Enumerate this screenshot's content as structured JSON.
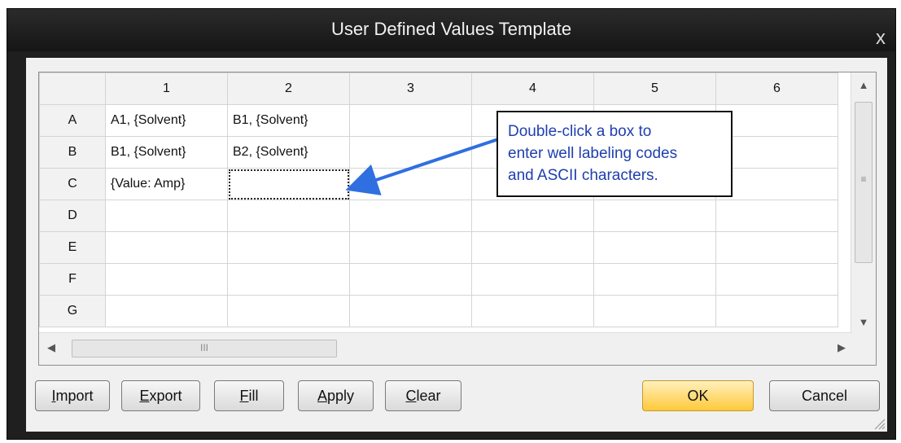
{
  "window": {
    "title": "User Defined Values Template",
    "close_symbol": "x"
  },
  "grid": {
    "columns": [
      "1",
      "2",
      "3",
      "4",
      "5",
      "6"
    ],
    "rows": [
      {
        "label": "A",
        "cells": [
          "A1, {Solvent}",
          "B1, {Solvent}",
          "",
          "",
          "",
          ""
        ]
      },
      {
        "label": "B",
        "cells": [
          "B1, {Solvent}",
          "B2, {Solvent}",
          "",
          "",
          "",
          ""
        ]
      },
      {
        "label": "C",
        "cells": [
          "{Value: Amp}",
          "",
          "",
          "",
          "",
          ""
        ]
      },
      {
        "label": "D",
        "cells": [
          "",
          "",
          "",
          "",
          "",
          ""
        ]
      },
      {
        "label": "E",
        "cells": [
          "",
          "",
          "",
          "",
          "",
          ""
        ]
      },
      {
        "label": "F",
        "cells": [
          "",
          "",
          "",
          "",
          "",
          ""
        ]
      },
      {
        "label": "G",
        "cells": [
          "",
          "",
          "",
          "",
          "",
          ""
        ]
      }
    ],
    "selected_cell": "C2"
  },
  "scrollbars": {
    "grip_v": "≡",
    "grip_h": "III",
    "up_icon": "up-arrow-icon",
    "down_icon": "down-arrow-icon",
    "left_icon": "left-arrow-icon",
    "right_icon": "right-arrow-icon"
  },
  "buttons": {
    "import": {
      "label": "Import",
      "accel": "I"
    },
    "export": {
      "label": "Export",
      "accel": "E"
    },
    "fill": {
      "label": "Fill",
      "accel": "F"
    },
    "apply": {
      "label": "Apply",
      "accel": "A"
    },
    "clear": {
      "label": "Clear",
      "accel": "C"
    },
    "ok": "OK",
    "cancel": "Cancel"
  },
  "callout": {
    "lines": [
      "Double-click a box to",
      "enter well labeling codes",
      "and ASCII characters."
    ],
    "text_color": "#1f3fae",
    "arrow_color": "#2f6fe0"
  }
}
